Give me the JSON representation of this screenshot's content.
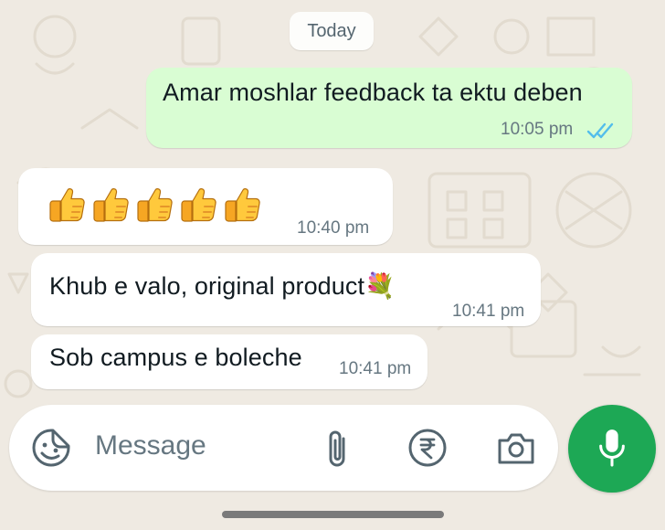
{
  "chat": {
    "date_divider": "Today",
    "messages": [
      {
        "direction": "outgoing",
        "text": "Amar moshlar feedback ta ektu deben",
        "time": "10:05 pm",
        "status": "read"
      },
      {
        "direction": "incoming",
        "text": "👍👍👍👍👍",
        "time": "10:40 pm"
      },
      {
        "direction": "incoming",
        "text": "Khub e valo, original product💐",
        "time": "10:41 pm"
      },
      {
        "direction": "incoming",
        "text": "Sob campus e boleche",
        "time": "10:41 pm"
      }
    ]
  },
  "composer": {
    "placeholder": "Message",
    "icons": [
      "sticker-icon",
      "paperclip-icon",
      "rupee-icon",
      "camera-icon",
      "mic-icon"
    ]
  },
  "colors": {
    "background": "#efeae2",
    "outgoing_bubble": "#d9fdd3",
    "incoming_bubble": "#ffffff",
    "read_ticks": "#53bdeb",
    "mic_button": "#1da855",
    "meta_text": "#667781"
  }
}
